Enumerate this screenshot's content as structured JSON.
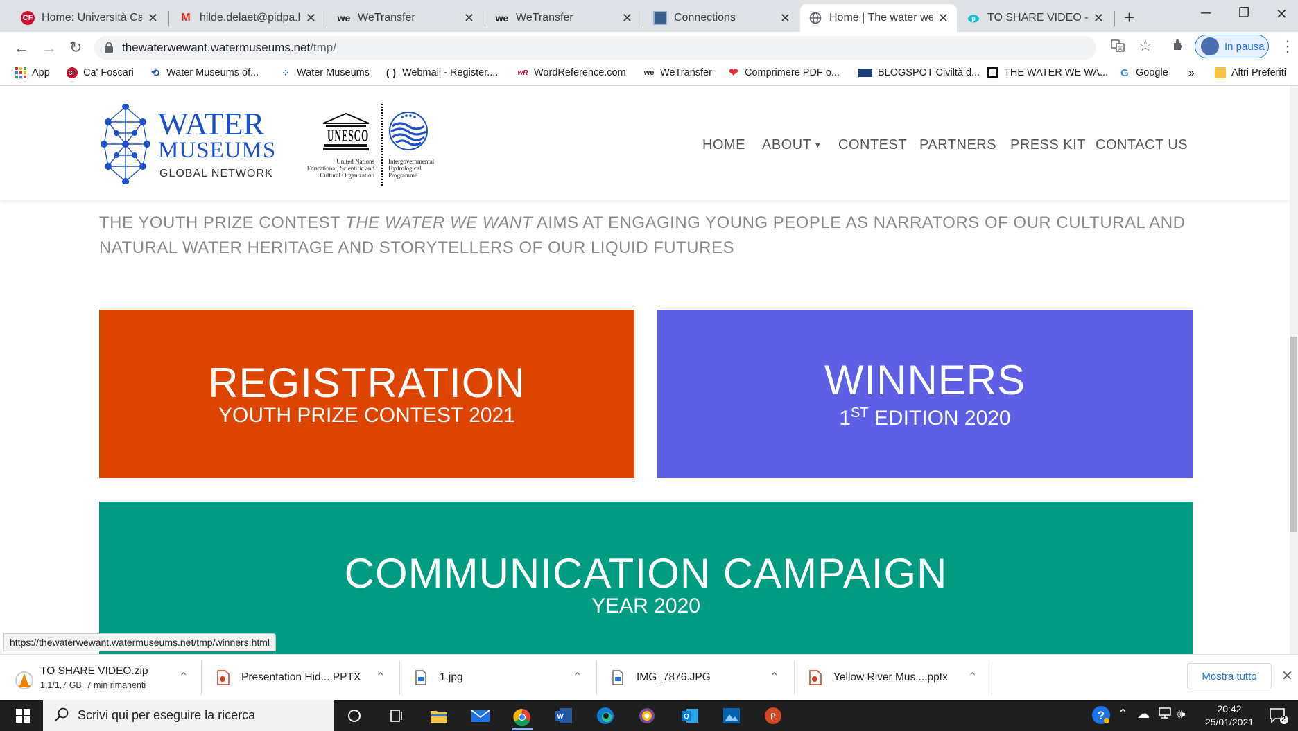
{
  "browser": {
    "tabs": [
      {
        "title": "Home: Università Ca' Fo",
        "favicon": "CF"
      },
      {
        "title": "hilde.delaet@pidpa.be",
        "favicon": "M"
      },
      {
        "title": "WeTransfer",
        "favicon": "we"
      },
      {
        "title": "WeTransfer",
        "favicon": "we"
      },
      {
        "title": "Connections",
        "favicon": ""
      },
      {
        "title": "Home | The water we w",
        "favicon": ""
      },
      {
        "title": "TO SHARE VIDEO - pCl",
        "favicon": ""
      }
    ],
    "url_host": "thewaterwewant.watermuseums.net",
    "url_path": "/tmp/",
    "profile_label": "In pausa",
    "bookmarks": [
      {
        "label": "App"
      },
      {
        "label": "Ca' Foscari"
      },
      {
        "label": "Water Museums of..."
      },
      {
        "label": "Water Museums"
      },
      {
        "label": "Webmail - Register...."
      },
      {
        "label": "WordReference.com"
      },
      {
        "label": "WeTransfer"
      },
      {
        "label": "Comprimere PDF o..."
      },
      {
        "label": "BLOGSPOT Civiltà d..."
      },
      {
        "label": "THE WATER WE WA..."
      },
      {
        "label": "Google"
      }
    ],
    "bookmarks_more": "»",
    "other_bookmarks": "Altri Preferiti",
    "status_url": "https://thewaterwewant.watermuseums.net/tmp/winners.html"
  },
  "site": {
    "logo": {
      "line1": "WATER",
      "line2": "MUSEUMS",
      "line3": "GLOBAL NETWORK"
    },
    "unesco": {
      "word": "UNESCO",
      "left_text": [
        "United Nations",
        "Educational, Scientific and",
        "Cultural Organization"
      ],
      "right_text": [
        "Intergovernmental",
        "Hydrological",
        "Programme"
      ]
    },
    "menu": [
      {
        "label": "HOME"
      },
      {
        "label": "ABOUT"
      },
      {
        "label": "CONTEST"
      },
      {
        "label": "PARTNERS"
      },
      {
        "label": "PRESS KIT"
      },
      {
        "label": "CONTACT US"
      }
    ],
    "intro_before": "THE YOUTH PRIZE CONTEST ",
    "intro_italic": "THE WATER WE WANT",
    "intro_after": " AIMS AT ENGAGING YOUNG PEOPLE AS NARRATORS OF OUR CULTURAL AND NATURAL WATER HERITAGE AND STORYTELLERS OF OUR LIQUID FUTURES",
    "cards": {
      "registration": {
        "title": "REGISTRATION",
        "subtitle": "YOUTH PRIZE CONTEST 2021",
        "color": "#dd4400"
      },
      "winners": {
        "title": "WINNERS",
        "sub_num": "1",
        "sub_sup": "ST",
        "sub_rest": " EDITION 2020",
        "color": "#5f5fe6"
      },
      "campaign": {
        "title": "COMMUNICATION CAMPAIGN",
        "subtitle": "YEAR 2020",
        "color": "#009c82"
      }
    }
  },
  "downloads": {
    "items": [
      {
        "name": "TO SHARE VIDEO.zip",
        "detail": "1,1/1,7 GB, 7 min rimanenti"
      },
      {
        "name": "Presentation Hid....PPTX"
      },
      {
        "name": "1.jpg"
      },
      {
        "name": "IMG_7876.JPG"
      },
      {
        "name": "Yellow River Mus....pptx"
      }
    ],
    "show_all": "Mostra tutto"
  },
  "taskbar": {
    "search_placeholder": "Scrivi qui per eseguire la ricerca",
    "time": "20:42",
    "date": "25/01/2021",
    "notif_count": "2"
  }
}
